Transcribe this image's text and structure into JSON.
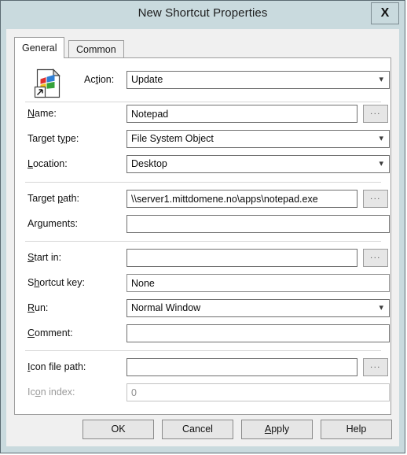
{
  "window": {
    "title": "New Shortcut Properties",
    "close_label": "X"
  },
  "tabs": [
    {
      "label": "General",
      "active": true
    },
    {
      "label": "Common",
      "active": false
    }
  ],
  "icon": {
    "name": "shortcut-document-windows-icon"
  },
  "form": {
    "action": {
      "label": "Action:",
      "accel": "ti",
      "value": "Update",
      "type": "combobox"
    },
    "name": {
      "label": "Name:",
      "accel": "N",
      "value": "Notepad",
      "type": "text",
      "browse": "..."
    },
    "target_type": {
      "label": "Target type:",
      "accel": "y",
      "value": "File System Object",
      "type": "combobox"
    },
    "location": {
      "label": "Location:",
      "accel": "L",
      "value": "Desktop",
      "type": "combobox"
    },
    "target_path": {
      "label": "Target path:",
      "accel": "p",
      "value": "\\\\server1.mittdomene.no\\apps\\notepad.exe",
      "type": "text",
      "browse": "..."
    },
    "arguments": {
      "label": "Arguments:",
      "accel": "g",
      "value": "",
      "type": "text"
    },
    "start_in": {
      "label": "Start in:",
      "accel": "S",
      "value": "",
      "type": "text",
      "browse": "..."
    },
    "shortcut_key": {
      "label": "Shortcut key:",
      "accel": "h",
      "value": "None",
      "type": "text"
    },
    "run": {
      "label": "Run:",
      "accel": "R",
      "value": "Normal Window",
      "type": "combobox"
    },
    "comment": {
      "label": "Comment:",
      "accel": "C",
      "value": "",
      "type": "text"
    },
    "icon_file_path": {
      "label": "Icon file path:",
      "accel": "I",
      "value": "",
      "type": "text",
      "browse": "..."
    },
    "icon_index": {
      "label": "Icon index:",
      "accel": "o",
      "value": "0",
      "type": "text",
      "disabled": true
    }
  },
  "buttons": {
    "ok": "OK",
    "cancel": "Cancel",
    "apply": "Apply",
    "help": "Help"
  },
  "colors": {
    "titlebar": "#c9dade",
    "dialog": "#f0f0f0",
    "panel": "#ffffff",
    "border": "#6f6f6f",
    "button": "#e6e6e6"
  }
}
